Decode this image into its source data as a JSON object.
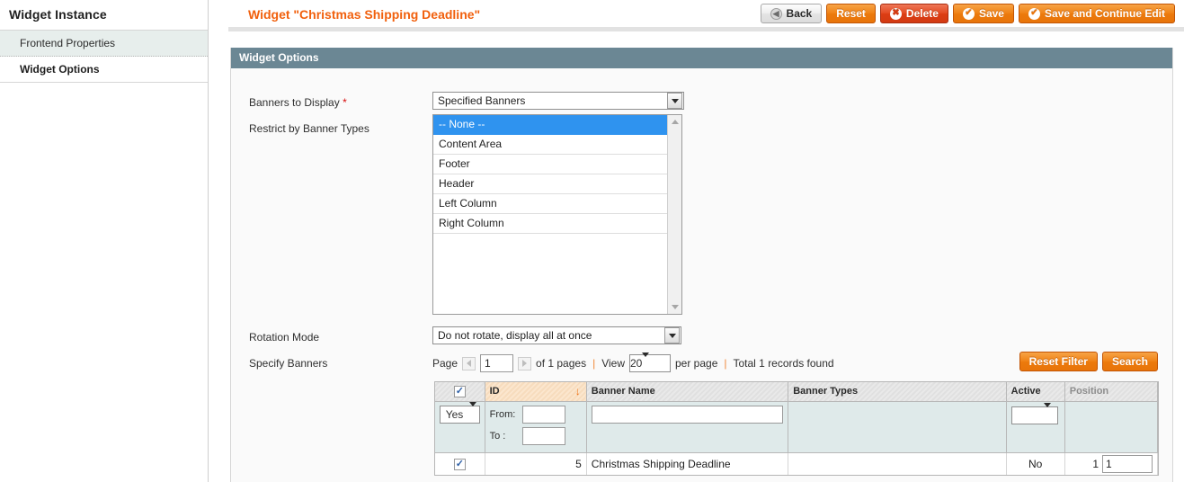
{
  "sidebar": {
    "title": "Widget Instance",
    "items": [
      {
        "label": "Frontend Properties",
        "state": "active"
      },
      {
        "label": "Widget Options",
        "state": "current"
      }
    ]
  },
  "header": {
    "title": "Widget \"Christmas Shipping Deadline\"",
    "buttons": [
      {
        "label": "Back",
        "icon": "back-arrow-icon",
        "style": "grey"
      },
      {
        "label": "Reset",
        "icon": "",
        "style": "orange"
      },
      {
        "label": "Delete",
        "icon": "delete-circle-icon",
        "style": "red"
      },
      {
        "label": "Save",
        "icon": "check-circle-icon",
        "style": "orange"
      },
      {
        "label": "Save and Continue Edit",
        "icon": "check-circle-icon",
        "style": "orange"
      }
    ]
  },
  "panel": {
    "heading": "Widget Options",
    "fields": {
      "banners_to_display": {
        "label": "Banners to Display",
        "required": "*",
        "value": "Specified Banners"
      },
      "restrict_by_banner_types": {
        "label": "Restrict by Banner Types",
        "options": [
          {
            "label": "-- None --",
            "selected": true
          },
          {
            "label": "Content Area",
            "selected": false
          },
          {
            "label": "Footer",
            "selected": false
          },
          {
            "label": "Header",
            "selected": false
          },
          {
            "label": "Left Column",
            "selected": false
          },
          {
            "label": "Right Column",
            "selected": false
          }
        ]
      },
      "rotation_mode": {
        "label": "Rotation Mode",
        "value": "Do not rotate, display all at once"
      },
      "specify_banners": {
        "label": "Specify Banners"
      }
    }
  },
  "pager": {
    "page_label": "Page",
    "page_value": "1",
    "of_pages": "of 1 pages",
    "view_label": "View",
    "per_page_value": "20",
    "per_page_label": "per page",
    "total_records": "Total 1 records found",
    "reset_filter_label": "Reset Filter",
    "search_label": "Search"
  },
  "grid": {
    "columns": [
      {
        "key": "checkbox",
        "label": ""
      },
      {
        "key": "id",
        "label": "ID",
        "sorted": true,
        "sort_dir": "desc"
      },
      {
        "key": "banner_name",
        "label": "Banner Name"
      },
      {
        "key": "banner_types",
        "label": "Banner Types"
      },
      {
        "key": "active",
        "label": "Active"
      },
      {
        "key": "position",
        "label": "Position",
        "dim": true
      }
    ],
    "filters": {
      "checkbox_select": "Yes",
      "id_from_label": "From:",
      "id_from_value": "",
      "id_to_label": "To :",
      "id_to_value": "",
      "banner_name_value": "",
      "banner_types_value": "",
      "active_value": "",
      "position_value": ""
    },
    "rows": [
      {
        "checked": true,
        "id": "5",
        "banner_name": "Christmas Shipping Deadline",
        "banner_types": "",
        "active": "No",
        "position_text": "1",
        "position_input": "1"
      }
    ]
  },
  "colors": {
    "accent_orange": "#f1600d",
    "panel_header": "#6b8794",
    "select_highlight": "#2f93ef",
    "filter_row": "#dfeaea",
    "sorted_column": "#fbe6ce"
  }
}
